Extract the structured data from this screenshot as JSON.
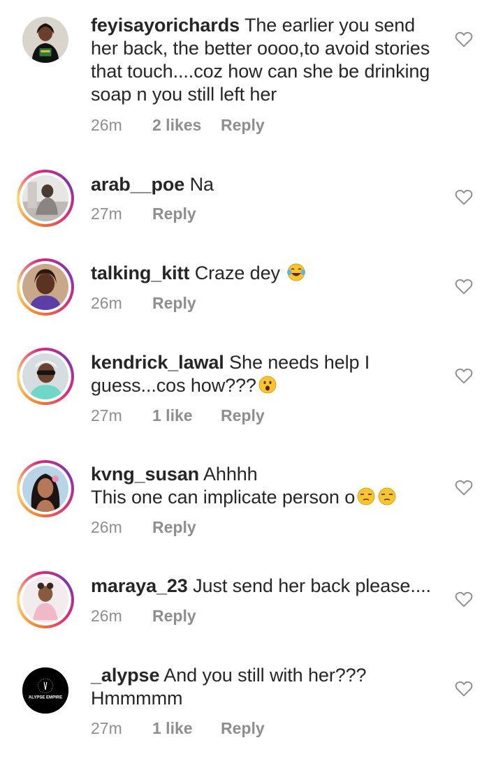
{
  "comments": [
    {
      "username": "feyisayorichards",
      "text": "The earlier you send her back, the better oooo,to avoid stories that touch....coz how can she be drinking soap n you still left her",
      "time": "26m",
      "likes": "2 likes",
      "reply": "Reply",
      "avatar": "feyisayorichards-avatar"
    },
    {
      "username": "arab__poe",
      "text": "Na",
      "time": "27m",
      "likes": "",
      "reply": "Reply",
      "avatar": "arab-poe-avatar"
    },
    {
      "username": "talking_kitt",
      "text": "Craze dey",
      "emoji": "face-with-tears-of-joy",
      "time": "26m",
      "likes": "",
      "reply": "Reply",
      "avatar": "talking-kitt-avatar"
    },
    {
      "username": "kendrick_lawal",
      "text": "She needs help I guess...cos how???",
      "emoji": "face-with-open-mouth",
      "time": "27m",
      "likes": "1 like",
      "reply": "Reply",
      "avatar": "kendrick-lawal-avatar"
    },
    {
      "username": "kvng_susan",
      "text": "Ahhhh",
      "text2": "This one can implicate person o",
      "emoji": "unamused-face",
      "time": "26m",
      "likes": "",
      "reply": "Reply",
      "avatar": "kvng-susan-avatar"
    },
    {
      "username": "maraya_23",
      "text": "Just send her back please....",
      "time": "26m",
      "likes": "",
      "reply": "Reply",
      "avatar": "maraya-23-avatar"
    },
    {
      "username": "_alypse",
      "text": "And you still with her???",
      "text2": "Hmmmmm",
      "time": "27m",
      "likes": "1 like",
      "reply": "Reply",
      "avatar": "alypse-avatar",
      "avatar_text": "ALYPSE EMPIRE"
    }
  ],
  "colors": {
    "text": "#262626",
    "meta": "#8e8e8e",
    "heart": "#8e8e8e",
    "story_ring": [
      "#f58529",
      "#dd2a7b",
      "#8134af"
    ]
  },
  "icons": {
    "like": "heart-outline-icon"
  }
}
